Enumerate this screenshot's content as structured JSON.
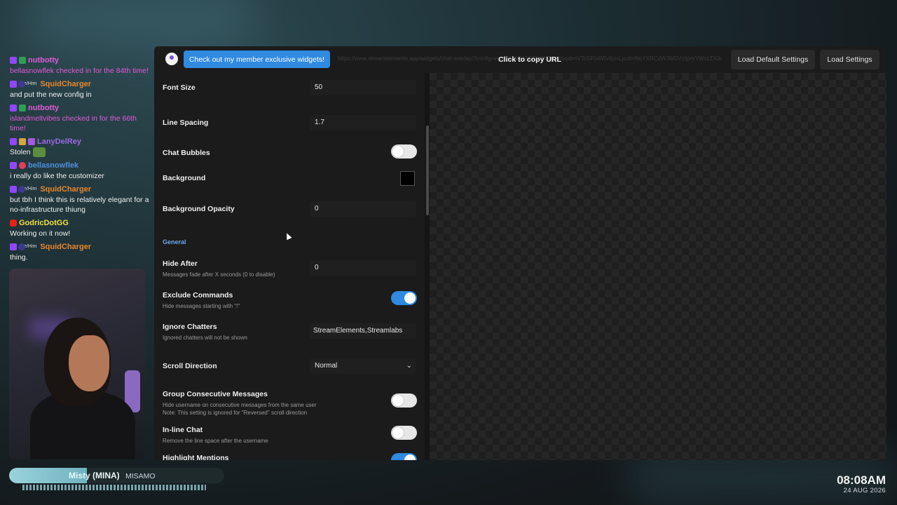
{
  "chat": [
    {
      "badges": [
        "twitch",
        "check"
      ],
      "pronoun": "",
      "user": "nutbotty",
      "user_color": "#e05bd8",
      "text": "bellasnowflek checked in for the 84th time!",
      "text_color": "#e05bd8"
    },
    {
      "badges": [
        "twitch",
        "sub"
      ],
      "pronoun": "He/Him",
      "user": "SquidCharger",
      "user_color": "#e8862c",
      "text": "and put the new config in",
      "text_color": "#f0f0f0"
    },
    {
      "badges": [
        "twitch",
        "check"
      ],
      "pronoun": "",
      "user": "nutbotty",
      "user_color": "#e05bd8",
      "text": "islandmeltvibes checked in for the 66th time!",
      "text_color": "#e05bd8"
    },
    {
      "badges": [
        "twitch",
        "gold",
        "purple"
      ],
      "pronoun": "",
      "user": "LanyDelRey",
      "user_color": "#9a6ae0",
      "text": "Stolen",
      "text_color": "#f0f0f0",
      "emote": "emote"
    },
    {
      "badges": [
        "twitch",
        "heart"
      ],
      "pronoun": "",
      "user": "bellasnowflek",
      "user_color": "#4f8fe0",
      "text": "i really do like the customizer",
      "text_color": "#f0f0f0"
    },
    {
      "badges": [
        "twitch",
        "sub"
      ],
      "pronoun": "He/Him",
      "user": "SquidCharger",
      "user_color": "#e8862c",
      "text": "but tbh I think this is relatively elegant for a no-infrastructure thiung",
      "text_color": "#f0f0f0"
    },
    {
      "badges": [
        "yt"
      ],
      "pronoun": "",
      "user": "GodricDotGG",
      "user_color": "#f0e040",
      "text": "Working on it now!",
      "text_color": "#f0f0f0"
    },
    {
      "badges": [
        "twitch",
        "sub"
      ],
      "pronoun": "He/Him",
      "user": "SquidCharger",
      "user_color": "#e8862c",
      "text": "thing.",
      "text_color": "#f0f0f0"
    }
  ],
  "now_playing": {
    "song": "Misty (MINA)",
    "artist": "MISAMO",
    "progress": 0.36
  },
  "clock": {
    "time": "08:08AM",
    "date": "24 AUG 2026"
  },
  "topbar": {
    "member_button": "Check out my member exclusive widgets!",
    "copy_url": "Click to copy URL",
    "url_faint": "https://www.streamelements.app/widgets/chat-overlay/?config=eyJmb250U2l6ZSI6NTAsImxpbmVTcGFjaW5nIjoxLjcsImNoYXRCdWJibGVzIjpmYWxzZX0=",
    "load_default": "Load Default Settings",
    "load_settings": "Load Settings"
  },
  "settings": {
    "font_size": {
      "label": "Font Size",
      "value": "50"
    },
    "line_spacing": {
      "label": "Line Spacing",
      "value": "1.7"
    },
    "chat_bubbles": {
      "label": "Chat Bubbles",
      "on": false
    },
    "background": {
      "label": "Background",
      "color": "#000000"
    },
    "background_opacity": {
      "label": "Background Opacity",
      "value": "0"
    },
    "section_general": "General",
    "hide_after": {
      "label": "Hide After",
      "sub": "Messages fade after X seconds (0 to disable)",
      "value": "0"
    },
    "exclude_commands": {
      "label": "Exclude Commands",
      "sub": "Hide messages starting with \"!\"",
      "on": true
    },
    "ignore_chatters": {
      "label": "Ignore Chatters",
      "sub": "Ignored chatters will not be shown",
      "value": "StreamElements,Streamlabs"
    },
    "scroll_direction": {
      "label": "Scroll Direction",
      "value": "Normal"
    },
    "group_consecutive": {
      "label": "Group Consecutive Messages",
      "sub1": "Hide username on consecutive messages from the same user",
      "sub2": "Note: This setting is ignored for \"Reversed\" scroll direction",
      "on": false
    },
    "inline_chat": {
      "label": "In-line Chat",
      "sub": "Remove the line space after the username",
      "on": false
    },
    "highlight_mentions": {
      "label": "Highlight Mentions",
      "on": true
    }
  }
}
